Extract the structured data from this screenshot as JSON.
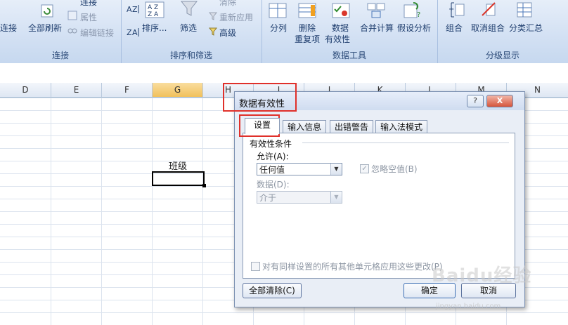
{
  "ribbon": {
    "connections_group": {
      "label": "连接",
      "items": {
        "connect": "连接",
        "refresh_all": "全部刷新",
        "connections": "连接",
        "properties": "属性",
        "edit_links": "编辑链接"
      }
    },
    "sort_filter_group": {
      "label": "排序和筛选",
      "items": {
        "sort": "排序...",
        "filter": "筛选",
        "clear": "清除",
        "reapply": "重新应用",
        "advanced": "高级"
      }
    },
    "data_tools_group": {
      "label": "数据工具",
      "items": {
        "text_to_columns": "分列",
        "remove_dup_line1": "删除",
        "remove_dup_line2": "重复项",
        "validation_line1": "数据",
        "validation_line2": "有效性",
        "consolidate": "合并计算",
        "what_if": "假设分析"
      }
    },
    "outline_group": {
      "label": "分级显示",
      "items": {
        "group": "组合",
        "ungroup": "取消组合",
        "subtotal": "分类汇总"
      }
    }
  },
  "columns": [
    "D",
    "E",
    "F",
    "G",
    "H",
    "I",
    "J",
    "K",
    "L",
    "M",
    "N"
  ],
  "selected_column": "G",
  "cell_text": "班级",
  "dialog": {
    "title": "数据有效性",
    "help_label": "?",
    "close_label": "X",
    "tabs": [
      "设置",
      "输入信息",
      "出错警告",
      "输入法模式"
    ],
    "active_tab": "设置",
    "section_title": "有效性条件",
    "allow_label": "允许(A):",
    "allow_value": "任何值",
    "ignore_blank_label": "忽略空值(B)",
    "ignore_blank_checked": "✓",
    "data_label": "数据(D):",
    "data_value": "介于",
    "apply_all_label": "对有同样设置的所有其他单元格应用这些更改(P)",
    "clear_all_label": "全部清除(C)",
    "ok_label": "确定",
    "cancel_label": "取消"
  },
  "watermark": {
    "text": "Baidu经验",
    "sub": "jingyan.baidu.com"
  },
  "colors": {
    "highlight": "#e0302a",
    "selected_col": "#f1c15c"
  }
}
